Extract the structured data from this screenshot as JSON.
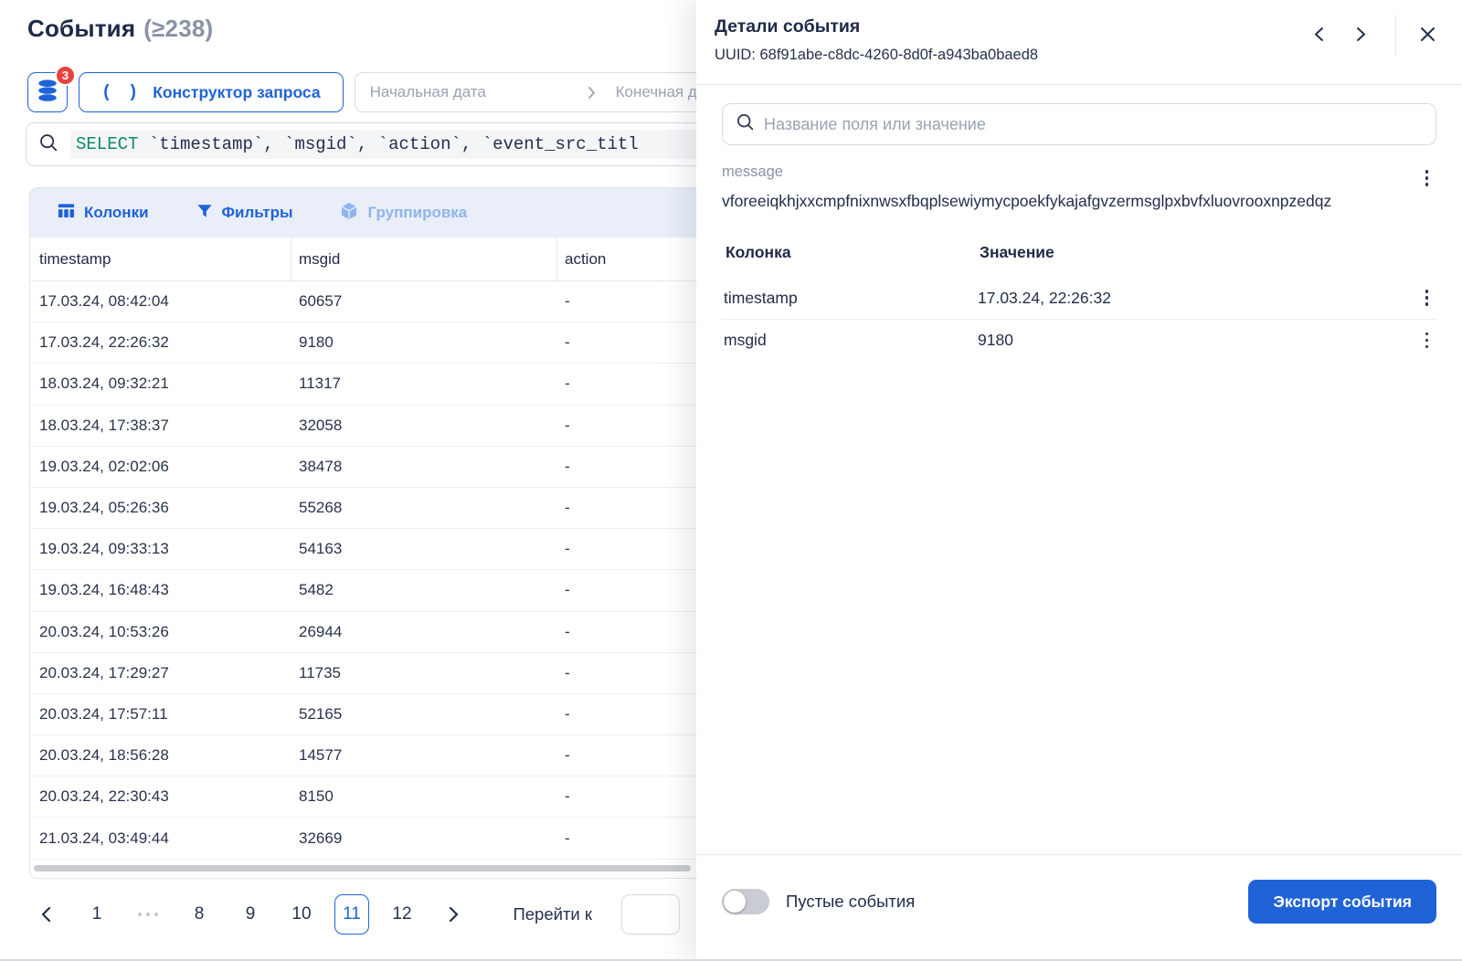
{
  "page": {
    "title": "События",
    "count": "(≥238)"
  },
  "controls": {
    "db_badge": "3",
    "query_builder_icon": "( )",
    "query_builder_label": "Конструктор запроса",
    "date_start_placeholder": "Начальная дата",
    "date_end_placeholder": "Конечная д",
    "sql_keyword": "SELECT",
    "sql_rest": " `timestamp`, `msgid`, `action`, `event_src_titl"
  },
  "toolbar": {
    "columns_label": "Колонки",
    "filters_label": "Фильтры",
    "grouping_label": "Группировка"
  },
  "table": {
    "headers": [
      "timestamp",
      "msgid",
      "action"
    ],
    "rows": [
      {
        "timestamp": "17.03.24, 08:42:04",
        "msgid": "60657",
        "action": "-"
      },
      {
        "timestamp": "17.03.24, 22:26:32",
        "msgid": "9180",
        "action": "-"
      },
      {
        "timestamp": "18.03.24, 09:32:21",
        "msgid": "11317",
        "action": "-"
      },
      {
        "timestamp": "18.03.24, 17:38:37",
        "msgid": "32058",
        "action": "-"
      },
      {
        "timestamp": "19.03.24, 02:02:06",
        "msgid": "38478",
        "action": "-"
      },
      {
        "timestamp": "19.03.24, 05:26:36",
        "msgid": "55268",
        "action": "-"
      },
      {
        "timestamp": "19.03.24, 09:33:13",
        "msgid": "54163",
        "action": "-"
      },
      {
        "timestamp": "19.03.24, 16:48:43",
        "msgid": "5482",
        "action": "-"
      },
      {
        "timestamp": "20.03.24, 10:53:26",
        "msgid": "26944",
        "action": "-"
      },
      {
        "timestamp": "20.03.24, 17:29:27",
        "msgid": "11735",
        "action": "-"
      },
      {
        "timestamp": "20.03.24, 17:57:11",
        "msgid": "52165",
        "action": "-"
      },
      {
        "timestamp": "20.03.24, 18:56:28",
        "msgid": "14577",
        "action": "-"
      },
      {
        "timestamp": "20.03.24, 22:30:43",
        "msgid": "8150",
        "action": "-"
      },
      {
        "timestamp": "21.03.24, 03:49:44",
        "msgid": "32669",
        "action": "-"
      }
    ]
  },
  "pagination": {
    "pages": [
      "1",
      "...",
      "8",
      "9",
      "10",
      "11",
      "12"
    ],
    "active_page": "11",
    "goto_label": "Перейти к",
    "goto_value": ""
  },
  "details": {
    "title": "Детали события",
    "uuid_line": "UUID: 68f91abe-c8dc-4260-8d0f-a943ba0baed8",
    "search_placeholder": "Название поля или значение",
    "message_label": "message",
    "message_value": "vforeeiqkhjxxcmpfnixnwsxfbqplsewiymycpoekfykajafgvzermsglpxbvfxluovrooxnpzedqz",
    "kv_headers": {
      "column": "Колонка",
      "value": "Значение"
    },
    "kv_rows": [
      {
        "key": "timestamp",
        "value": "17.03.24, 22:26:32"
      },
      {
        "key": "msgid",
        "value": "9180"
      }
    ],
    "footer": {
      "toggle_label": "Пустые события",
      "export_label": "Экспорт события"
    }
  },
  "icons": {
    "database": "stacked-discs",
    "query_builder": "( )",
    "search": "magnifier",
    "columns": "table-columns",
    "filters": "funnel",
    "grouping": "cube",
    "kebab": "⋮",
    "prev": "‹",
    "next": "›",
    "close": "×"
  },
  "colors": {
    "primary_blue": "#2063d6",
    "disabled_blue": "#8fb5ec",
    "badge_red": "#e8423e",
    "text_dark": "#1e2a47",
    "text_gray": "#8a92a3",
    "sql_keyword_green": "#0d8a68",
    "toolbar_bg": "#e9eef8"
  }
}
